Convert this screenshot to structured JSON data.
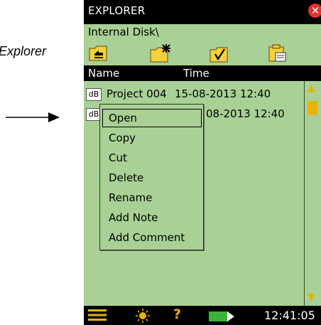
{
  "annotation": {
    "label": "Explorer"
  },
  "window": {
    "title": "EXPLORER"
  },
  "path": {
    "label": "Internal Disk\\"
  },
  "toolbar": {
    "icons": [
      "folder-up-icon",
      "new-folder-icon",
      "select-folder-icon",
      "paste-icon"
    ]
  },
  "columns": {
    "name": "Name",
    "time": "Time"
  },
  "files": [
    {
      "type": "dB",
      "name": "Project 004",
      "time": "15-08-2013 12:40"
    },
    {
      "type": "dB",
      "name": "",
      "time": "08-2013 12:40"
    }
  ],
  "context_menu": {
    "items": [
      "Open",
      "Copy",
      "Cut",
      "Delete",
      "Rename",
      "Add Note",
      "Add Comment"
    ],
    "selected": "Open"
  },
  "status": {
    "clock": "12:41:05",
    "icons": [
      "menu-icon",
      "backlight-icon",
      "help-icon",
      "battery-icon"
    ]
  },
  "colors": {
    "background": "#a9d195",
    "accent": "#e8b400",
    "close": "#e0322b"
  }
}
